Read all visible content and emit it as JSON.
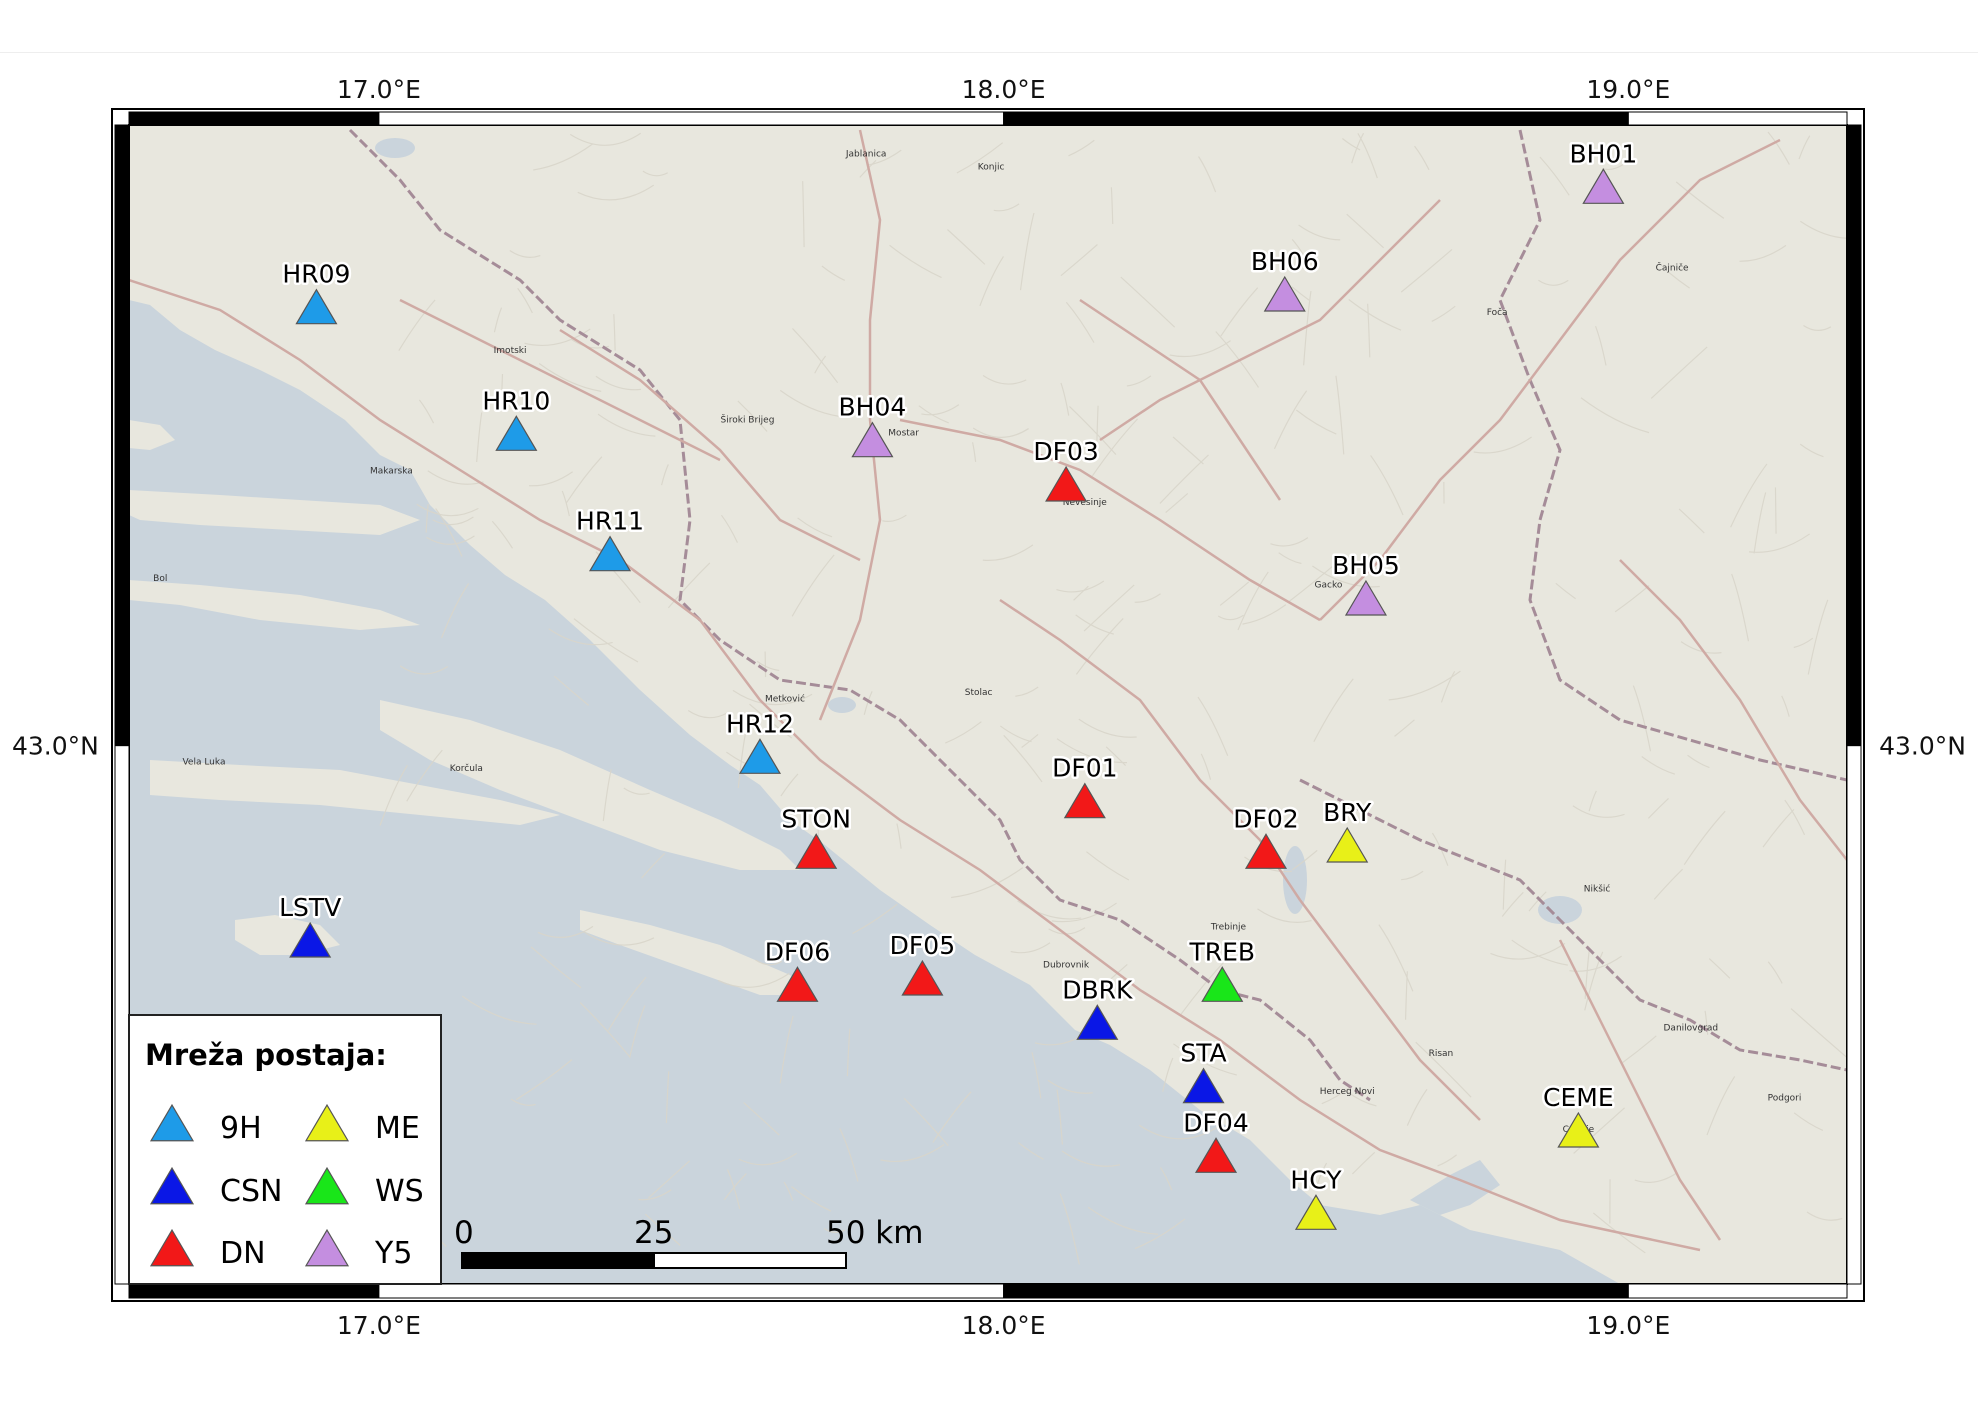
{
  "map": {
    "lon_range": [
      16.6,
      19.35
    ],
    "lat_range": [
      42.15,
      43.98
    ],
    "colors": {
      "sea": "#cad4dc",
      "land": "#e9e8df",
      "roads": "#c9a9a3",
      "border": "#9b8b94"
    }
  },
  "coordinates": {
    "top_lon": [
      {
        "value": 17.0,
        "label": "17.0°E"
      },
      {
        "value": 18.0,
        "label": "18.0°E"
      },
      {
        "value": 19.0,
        "label": "19.0°E"
      }
    ],
    "bottom_lon": [
      {
        "value": 17.0,
        "label": "17.0°E"
      },
      {
        "value": 18.0,
        "label": "18.0°E"
      },
      {
        "value": 19.0,
        "label": "19.0°E"
      }
    ],
    "left_lat": [
      {
        "value": 43.0,
        "label": "43.0°N"
      }
    ],
    "right_lat": [
      {
        "value": 43.0,
        "label": "43.0°N"
      }
    ]
  },
  "networks": [
    {
      "code": "9H",
      "color": "#1e9be8"
    },
    {
      "code": "CSN",
      "color": "#0a17e6"
    },
    {
      "code": "DN",
      "color": "#f21818"
    },
    {
      "code": "ME",
      "color": "#e8f018"
    },
    {
      "code": "WS",
      "color": "#19e619"
    },
    {
      "code": "Y5",
      "color": "#c48ee0"
    }
  ],
  "stations": [
    {
      "code": "BH01",
      "network": "Y5",
      "lon": 18.96,
      "lat": 43.88
    },
    {
      "code": "BH06",
      "network": "Y5",
      "lon": 18.45,
      "lat": 43.71
    },
    {
      "code": "HR09",
      "network": "9H",
      "lon": 16.9,
      "lat": 43.69
    },
    {
      "code": "HR10",
      "network": "9H",
      "lon": 17.22,
      "lat": 43.49
    },
    {
      "code": "BH04",
      "network": "Y5",
      "lon": 17.79,
      "lat": 43.48
    },
    {
      "code": "DF03",
      "network": "DN",
      "lon": 18.1,
      "lat": 43.41
    },
    {
      "code": "HR11",
      "network": "9H",
      "lon": 17.37,
      "lat": 43.3
    },
    {
      "code": "BH05",
      "network": "Y5",
      "lon": 18.58,
      "lat": 43.23
    },
    {
      "code": "HR12",
      "network": "9H",
      "lon": 17.61,
      "lat": 42.98
    },
    {
      "code": "DF01",
      "network": "DN",
      "lon": 18.13,
      "lat": 42.91
    },
    {
      "code": "BRY",
      "network": "ME",
      "lon": 18.55,
      "lat": 42.84
    },
    {
      "code": "DF02",
      "network": "DN",
      "lon": 18.42,
      "lat": 42.83
    },
    {
      "code": "STON",
      "network": "DN",
      "lon": 17.7,
      "lat": 42.83
    },
    {
      "code": "LSTV",
      "network": "CSN",
      "lon": 16.89,
      "lat": 42.69
    },
    {
      "code": "DF06",
      "network": "DN",
      "lon": 17.67,
      "lat": 42.62
    },
    {
      "code": "DF05",
      "network": "DN",
      "lon": 17.87,
      "lat": 42.63
    },
    {
      "code": "TREB",
      "network": "WS",
      "lon": 18.35,
      "lat": 42.62
    },
    {
      "code": "DBRK",
      "network": "CSN",
      "lon": 18.15,
      "lat": 42.56
    },
    {
      "code": "STA",
      "network": "CSN",
      "lon": 18.32,
      "lat": 42.46
    },
    {
      "code": "CEME",
      "network": "ME",
      "lon": 18.92,
      "lat": 42.39
    },
    {
      "code": "DF04",
      "network": "DN",
      "lon": 18.34,
      "lat": 42.35
    },
    {
      "code": "HCY",
      "network": "ME",
      "lon": 18.5,
      "lat": 42.26
    }
  ],
  "places": [
    {
      "name": "Jablanica",
      "lon": 17.78,
      "lat": 43.93
    },
    {
      "name": "Konjic",
      "lon": 17.98,
      "lat": 43.91
    },
    {
      "name": "Imotski",
      "lon": 17.21,
      "lat": 43.62
    },
    {
      "name": "Široki Brijeg",
      "lon": 17.59,
      "lat": 43.51
    },
    {
      "name": "Mostar",
      "lon": 17.84,
      "lat": 43.49
    },
    {
      "name": "Makarska",
      "lon": 17.02,
      "lat": 43.43
    },
    {
      "name": "Nevesinje",
      "lon": 18.13,
      "lat": 43.38
    },
    {
      "name": "Foča",
      "lon": 18.79,
      "lat": 43.68
    },
    {
      "name": "Čajniče",
      "lon": 19.07,
      "lat": 43.75
    },
    {
      "name": "Gacko",
      "lon": 18.52,
      "lat": 43.25
    },
    {
      "name": "Stolac",
      "lon": 17.96,
      "lat": 43.08
    },
    {
      "name": "Metković",
      "lon": 17.65,
      "lat": 43.07
    },
    {
      "name": "Korčula",
      "lon": 17.14,
      "lat": 42.96
    },
    {
      "name": "Vela Luka",
      "lon": 16.72,
      "lat": 42.97
    },
    {
      "name": "Bol",
      "lon": 16.65,
      "lat": 43.26
    },
    {
      "name": "Dubrovnik",
      "lon": 18.1,
      "lat": 42.65
    },
    {
      "name": "Trebinje",
      "lon": 18.36,
      "lat": 42.71
    },
    {
      "name": "Nikšić",
      "lon": 18.95,
      "lat": 42.77
    },
    {
      "name": "Risan",
      "lon": 18.7,
      "lat": 42.51
    },
    {
      "name": "Herceg Novi",
      "lon": 18.55,
      "lat": 42.45
    },
    {
      "name": "Danilovgrad",
      "lon": 19.1,
      "lat": 42.55
    },
    {
      "name": "Cetinje",
      "lon": 18.92,
      "lat": 42.39
    },
    {
      "name": "Podgori",
      "lon": 19.25,
      "lat": 42.44
    }
  ],
  "legend": {
    "title": "Mreža postaja:",
    "items": [
      "9H",
      "CSN",
      "DN",
      "ME",
      "WS",
      "Y5"
    ]
  },
  "scalebar": {
    "labels": [
      "0",
      "25",
      "50 km"
    ]
  }
}
